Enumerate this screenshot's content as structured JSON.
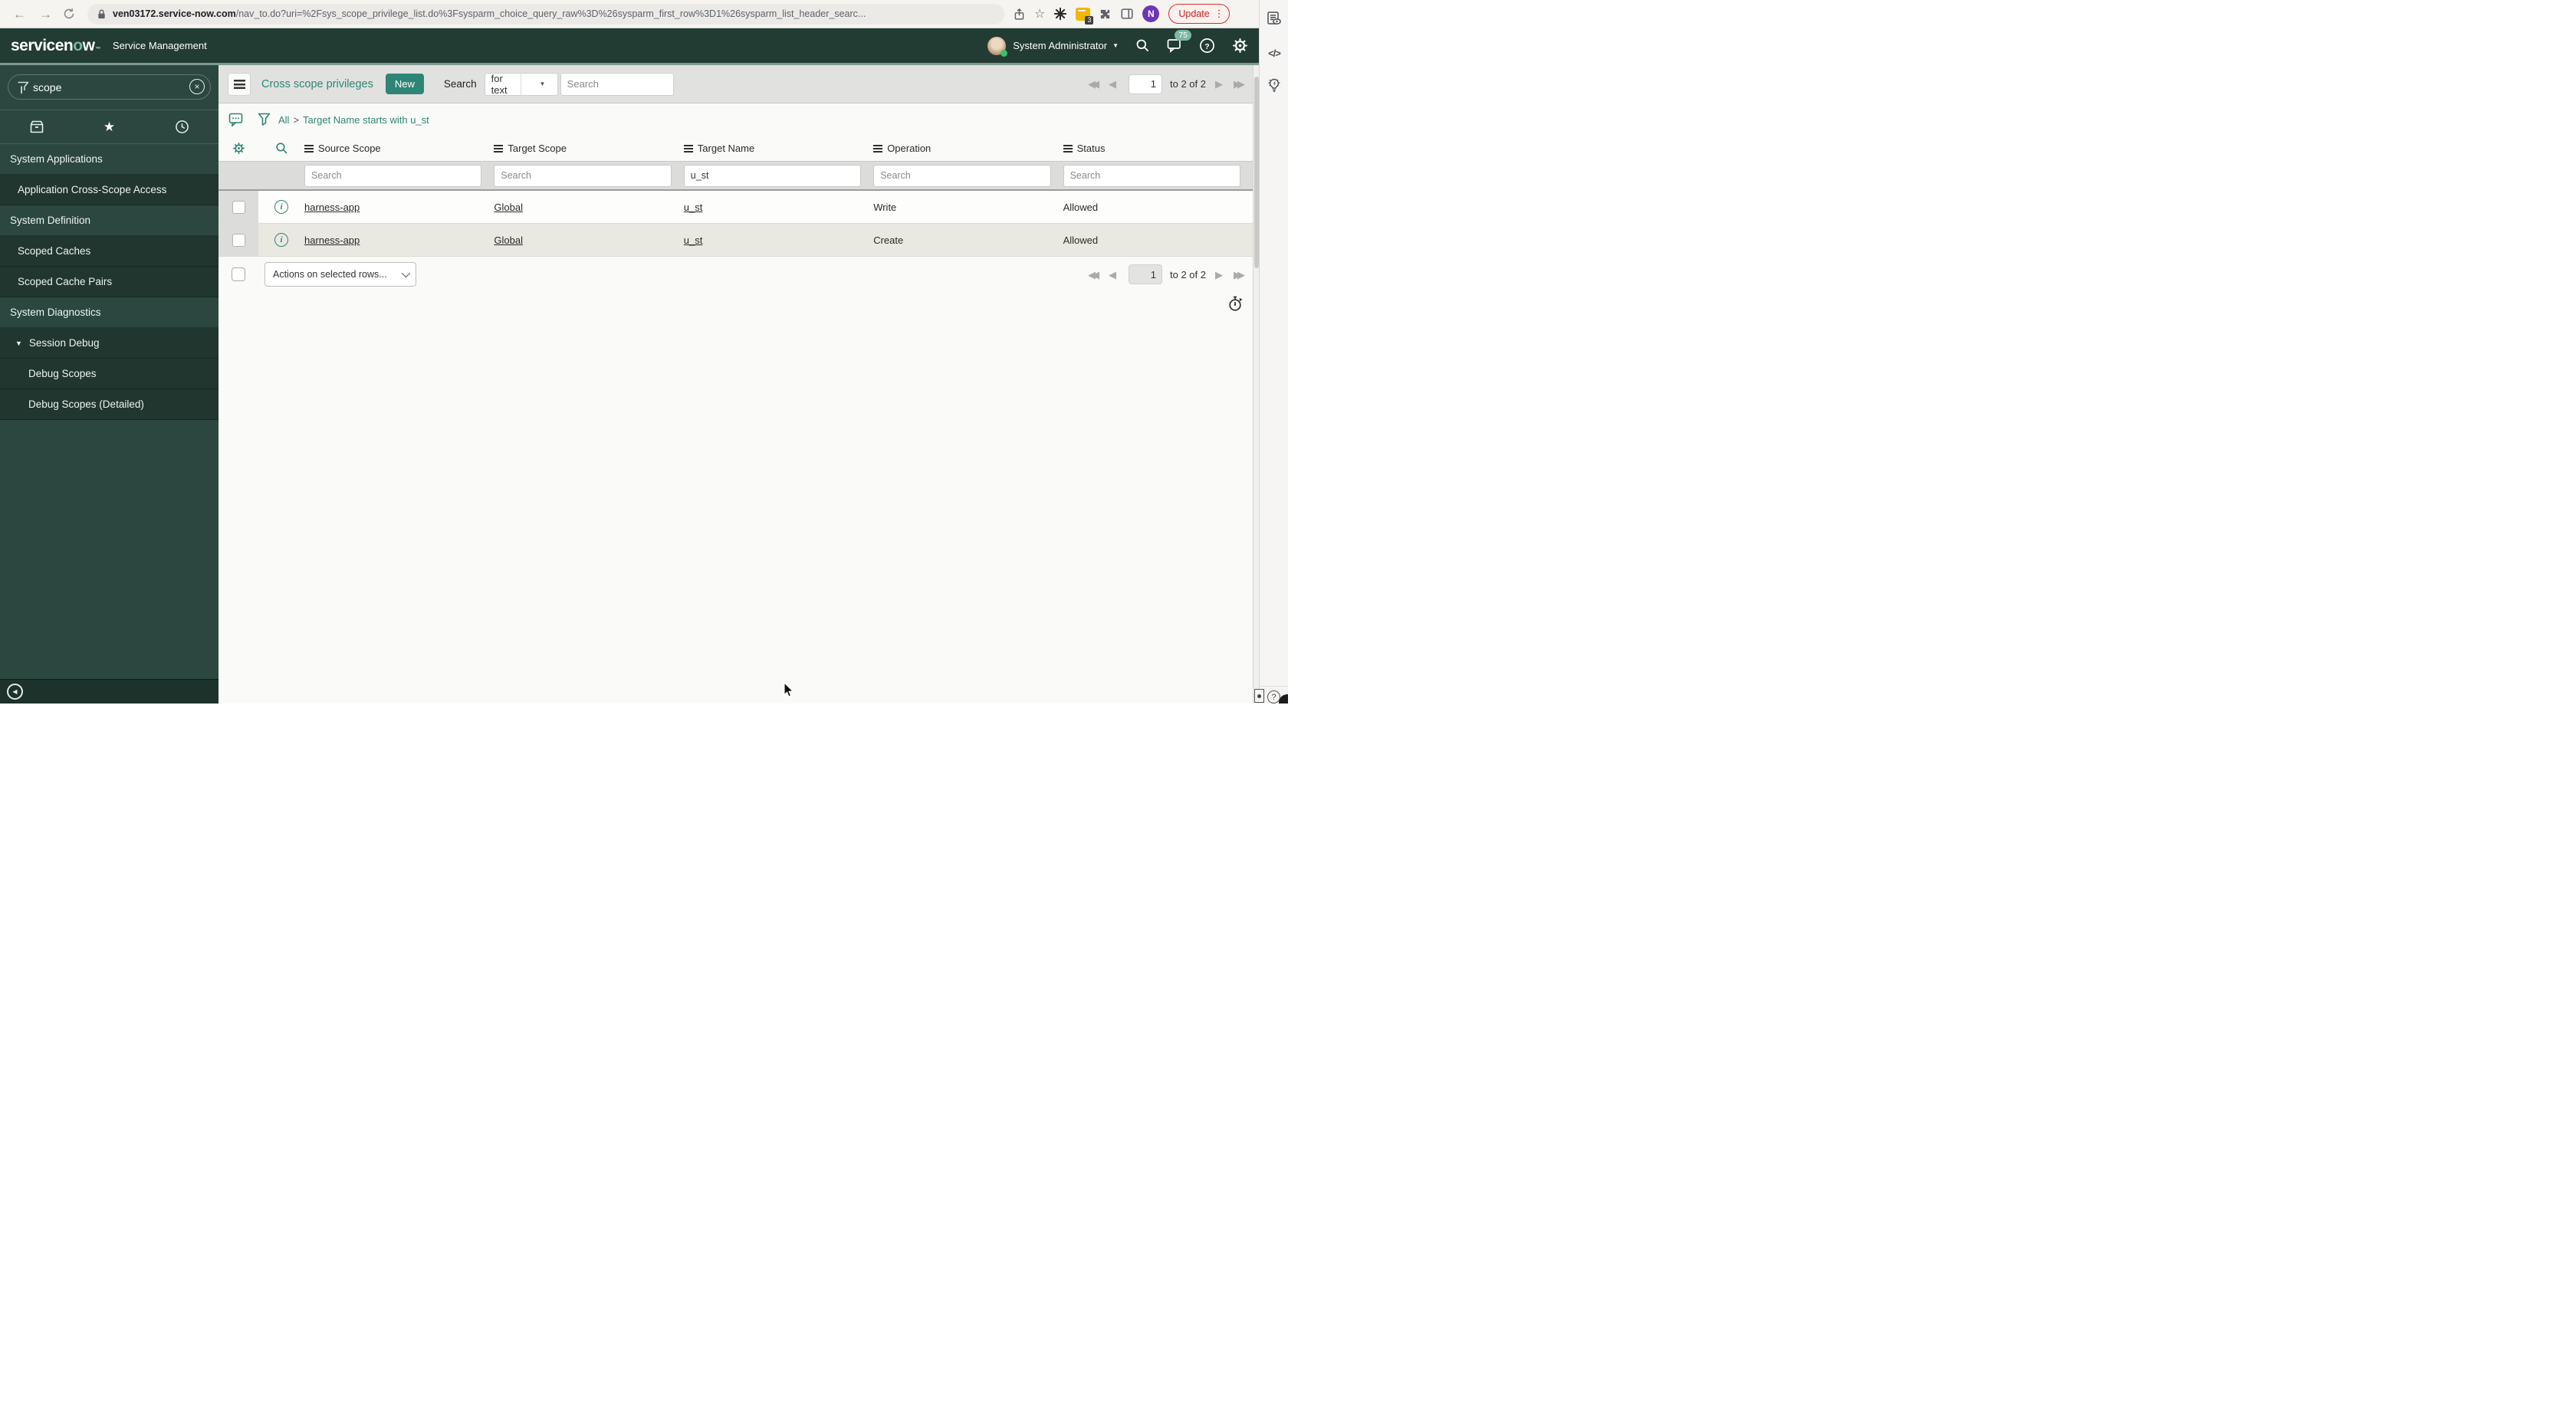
{
  "colors": {
    "teal_accent": "#2e8575",
    "header_green": "#223b33",
    "sidebar_green": "#2b473f",
    "accent_line": "#7d9a8e",
    "update_red": "#c5221f",
    "badge_green": "#7ab8a4"
  },
  "icons": {
    "back": "←",
    "forward": "→",
    "star_outline": "☆",
    "favorites_star": "★",
    "triangle_down": "▼",
    "caret_down": "▼",
    "clear": "×",
    "first_page": "◀◀",
    "prev_page": "◀",
    "next_page": "▶",
    "last_page": "▶▶",
    "collapse_left": "◀",
    "info": "i",
    "help": "?",
    "code": "</>",
    "ellipsis_menu": "⋮"
  },
  "browser": {
    "url_domain": "ven03172.service-now.com",
    "url_path": "/nav_to.do?uri=%2Fsys_scope_privilege_list.do%3Fsysparm_choice_query_raw%3D%26sysparm_first_row%3D1%26sysparm_list_header_searc...",
    "extension_badge": "3",
    "avatar_letter": "N",
    "update_label": "Update"
  },
  "header": {
    "logo_prefix": "servicen",
    "logo_o": "o",
    "logo_suffix": "w",
    "trademark": "™",
    "product": "Service Management",
    "user_name": "System Administrator",
    "notification_count": "75"
  },
  "sidebar": {
    "search_value": "scope",
    "items": [
      {
        "label": "System Applications"
      },
      {
        "label": "Application Cross-Scope Access"
      },
      {
        "label": "System Definition"
      },
      {
        "label": "Scoped Caches"
      },
      {
        "label": "Scoped Cache Pairs"
      },
      {
        "label": "System Diagnostics"
      },
      {
        "label": "Session Debug"
      },
      {
        "label": "Debug Scopes"
      },
      {
        "label": "Debug Scopes (Detailed)"
      }
    ]
  },
  "toolbar": {
    "title": "Cross scope privileges",
    "new_button": "New",
    "search_label": "Search",
    "search_mode": "for text",
    "search_placeholder": "Search"
  },
  "breadcrumb": {
    "root": "All",
    "separator": ">",
    "condition": "Target Name starts with u_st"
  },
  "list": {
    "columns": [
      "Source Scope",
      "Target Scope",
      "Target Name",
      "Operation",
      "Status"
    ],
    "filters": [
      {
        "placeholder": "Search"
      },
      {
        "placeholder": "Search"
      },
      {
        "value": "u_st"
      },
      {
        "placeholder": "Search"
      },
      {
        "placeholder": "Search"
      }
    ],
    "rows": [
      {
        "source_scope": "harness-app",
        "target_scope": "Global",
        "target_name": "u_st",
        "operation": "Write",
        "status": "Allowed"
      },
      {
        "source_scope": "harness-app",
        "target_scope": "Global",
        "target_name": "u_st",
        "operation": "Create",
        "status": "Allowed"
      }
    ],
    "actions_placeholder": "Actions on selected rows..."
  },
  "pagination": {
    "page": "1",
    "range_label": "to 2 of 2"
  }
}
